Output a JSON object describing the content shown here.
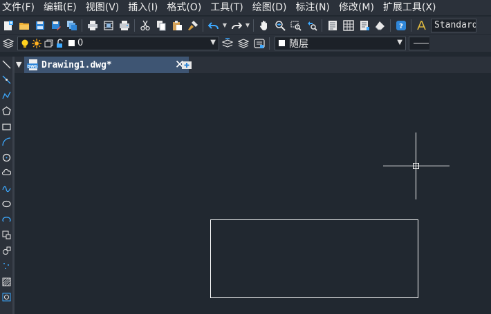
{
  "menu": [
    {
      "label": "文件(F)"
    },
    {
      "label": "编辑(E)"
    },
    {
      "label": "视图(V)"
    },
    {
      "label": "插入(I)"
    },
    {
      "label": "格式(O)"
    },
    {
      "label": "工具(T)"
    },
    {
      "label": "绘图(D)"
    },
    {
      "label": "标注(N)"
    },
    {
      "label": "修改(M)"
    },
    {
      "label": "扩展工具(X)"
    }
  ],
  "toolbar": {
    "text_style": "Standard"
  },
  "layer": {
    "current": "0"
  },
  "properties": {
    "color": "随层"
  },
  "document": {
    "tab_title": "Drawing1.dwg*",
    "close_glyph": "✕"
  },
  "colors": {
    "background": "#212830",
    "panel": "#2b313a",
    "active_tab": "#3e5573",
    "accent_blue": "#3da9ff",
    "crosshair": "#ffffff"
  }
}
